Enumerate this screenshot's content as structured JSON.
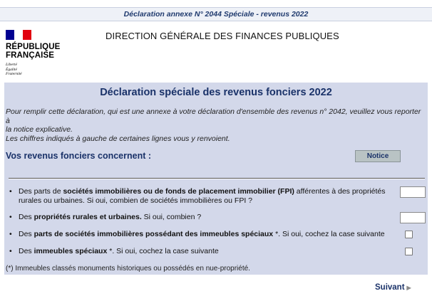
{
  "header": {
    "form_title": "Déclaration annexe N° 2044 Spéciale - revenus 2022"
  },
  "logo": {
    "name_line1": "RÉPUBLIQUE",
    "name_line2": "FRANÇAISE",
    "motto_line1": "Liberté",
    "motto_line2": "Égalité",
    "motto_line3": "Fraternité",
    "flag_colors": [
      "#000091",
      "#ffffff",
      "#e1000f"
    ]
  },
  "agency": "DIRECTION GÉNÉRALE DES FINANCES PUBLIQUES",
  "panel": {
    "title": "Déclaration spéciale des revenus fonciers 2022",
    "intro_line1": "Pour remplir cette déclaration, qui est une annexe à votre déclaration d'ensemble des revenus n° 2042, veuillez vous reporter à",
    "intro_line2": "la notice explicative.",
    "intro_line3": "Les chiffres indiqués à gauche de certaines lignes vous y renvoient.",
    "section_title": "Vos revenus fonciers concernent :",
    "notice_button": "Notice",
    "questions": {
      "q1_pre": "Des parts de ",
      "q1_bold": "sociétés immobilières ou de fonds de placement immobilier (FPI)",
      "q1_post": " afférentes à des propriétés",
      "q1_line2": "rurales ou urbaines. Si oui, combien de sociétés immobilières ou FPI ?",
      "q1_value": "",
      "q2_pre": "Des ",
      "q2_bold": "propriétés rurales et urbaines.",
      "q2_post": " Si oui, combien ?",
      "q2_value": "",
      "q3_pre": "Des ",
      "q3_bold": "parts de sociétés immobilières possédant des immeubles spéciaux",
      "q3_post": " *. Si oui, cochez la case suivante",
      "q3_checked": false,
      "q4_pre": "Des ",
      "q4_bold": "immeubles spéciaux",
      "q4_post": " *. Si oui, cochez la case suivante",
      "q4_checked": false
    },
    "footnote": "(*) Immeubles classés monuments historiques ou possédés en nue-propriété."
  },
  "navigation": {
    "next_label": "Suivant"
  },
  "colors": {
    "accent": "#1a3269",
    "panel_bg": "#d3d8ea"
  }
}
